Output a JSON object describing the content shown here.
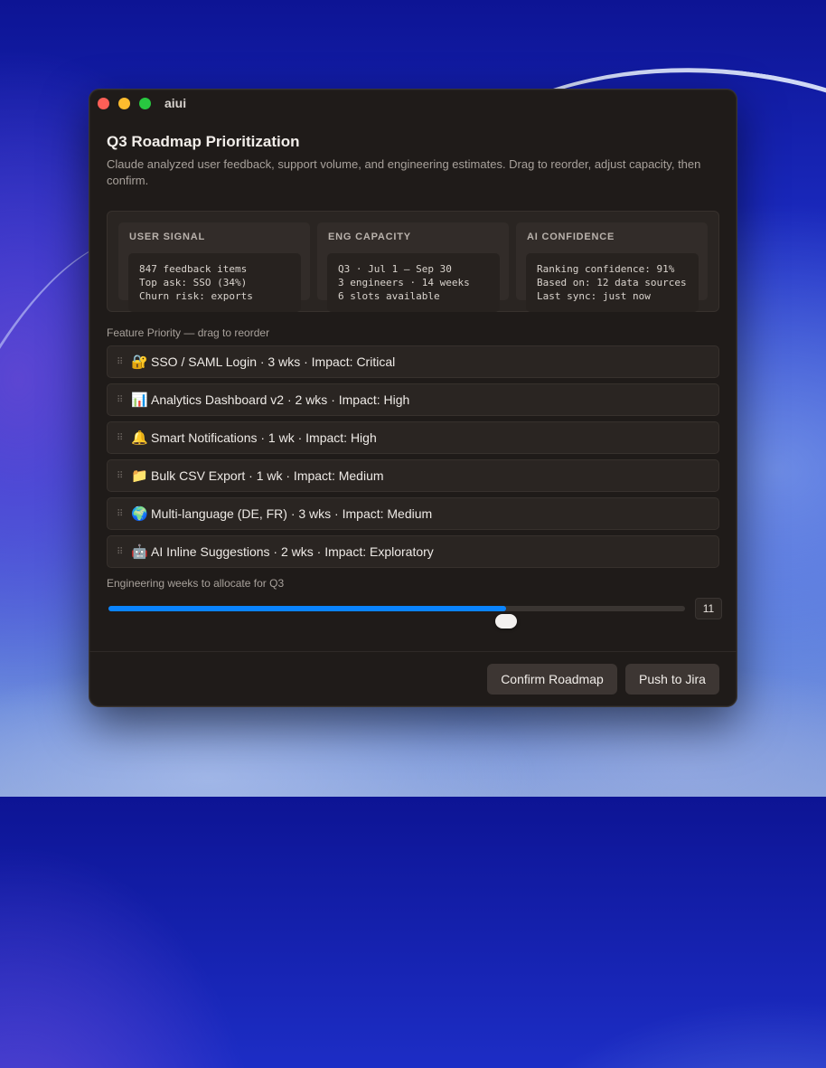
{
  "window": {
    "app_title": "aiui"
  },
  "header": {
    "title": "Q3 Roadmap Prioritization",
    "subtitle": "Claude analyzed user feedback, support volume, and engineering estimates. Drag to reorder, adjust capacity, then confirm."
  },
  "cards": [
    {
      "title": "USER SIGNAL",
      "lines": [
        "847 feedback items",
        "Top ask: SSO (34%)",
        "Churn risk: exports"
      ]
    },
    {
      "title": "ENG CAPACITY",
      "lines": [
        "Q3 · Jul 1 — Sep 30",
        "3 engineers · 14 weeks",
        "6 slots available"
      ]
    },
    {
      "title": "AI CONFIDENCE",
      "lines": [
        "Ranking confidence: 91%",
        "Based on: 12 data sources",
        "Last sync: just now"
      ]
    }
  ],
  "feature_list": {
    "label": "Feature Priority — drag to reorder",
    "grip_icon": "⠿",
    "items": [
      {
        "icon": "lock-key-icon",
        "emoji": "🔐",
        "label": "SSO / SAML Login · 3 wks · Impact: Critical"
      },
      {
        "icon": "bar-chart-icon",
        "emoji": "📊",
        "label": "Analytics Dashboard v2 · 2 wks · Impact: High"
      },
      {
        "icon": "bell-icon",
        "emoji": "🔔",
        "label": "Smart Notifications · 1 wk · Impact: High"
      },
      {
        "icon": "folder-icon",
        "emoji": "📁",
        "label": "Bulk CSV Export · 1 wk · Impact: Medium"
      },
      {
        "icon": "globe-icon",
        "emoji": "🌍",
        "label": "Multi-language (DE, FR) · 3 wks · Impact: Medium"
      },
      {
        "icon": "robot-icon",
        "emoji": "🤖",
        "label": "AI Inline Suggestions · 2 wks · Impact: Exploratory"
      }
    ]
  },
  "capacity": {
    "label": "Engineering weeks to allocate for Q3",
    "value": "11",
    "fraction": 0.69
  },
  "footer": {
    "confirm_label": "Confirm Roadmap",
    "jira_label": "Push to Jira"
  },
  "colors": {
    "accent": "#0a84ff",
    "window_bg": "#1f1b19",
    "close": "#fe5f57",
    "minimize": "#febc2e",
    "zoom": "#28c840"
  }
}
